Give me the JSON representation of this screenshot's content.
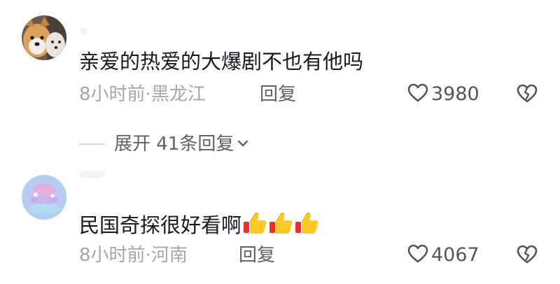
{
  "comments": [
    {
      "text": "亲爱的热爱的大爆剧不也有他吗",
      "time": "8小时前",
      "location": "黑龙江",
      "reply_label": "回复",
      "likes": "3980"
    },
    {
      "text": "民国奇探很好看啊",
      "time": "8小时前",
      "location": "河南",
      "reply_label": "回复",
      "likes": "4067"
    }
  ],
  "expand_replies": {
    "label": "展开 41条回复"
  },
  "icons": {
    "like": "heart-outline-icon",
    "dislike": "broken-heart-icon",
    "expand": "chevron-down-icon",
    "emoji": "thumbs-up-emoji"
  },
  "colors": {
    "text": "#161823",
    "meta": "#a6a6ab",
    "action": "#606066"
  }
}
